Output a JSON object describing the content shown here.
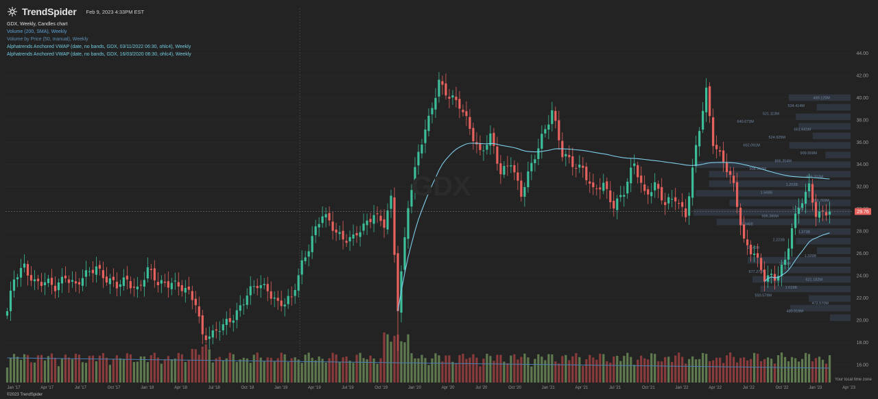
{
  "header": {
    "brand": "TrendSpider",
    "timestamp": "Feb 9, 2023 4:33PM EST"
  },
  "legend": {
    "title": "GDX, Weekly, Candles chart",
    "volume_sma": "Volume (200, SMA), Weekly",
    "vbp": "Volume by Price (50, manual), Weekly",
    "avwap1": "Alphatrends Anchored VWAP (date, no bands, GDX, 03/11/2022 06:30, ohlc4), Weekly",
    "avwap2": "Alphatrends Anchored VWAP (date, no bands, GDX, 16/03/2020 06:30, ohlc4), Weekly"
  },
  "footer": {
    "copyright": "©2023 TrendSpider",
    "timezone": "Your local time zone"
  },
  "colors": {
    "background": "#232323",
    "up": "#3dbf9c",
    "down": "#e8625e",
    "vol_up": "#5f7a4f",
    "vol_down": "#8a3b3b",
    "vwap": "#7fd0ec",
    "vbp": "#3a4656",
    "price_tag": "#e8625e"
  },
  "chart_data": {
    "type": "candlestick",
    "symbol": "GDX",
    "interval": "Weekly",
    "ylim": [
      15,
      46
    ],
    "y_ticks": [
      "16.00",
      "18.00",
      "20.00",
      "22.00",
      "24.00",
      "26.00",
      "28.00",
      "30.00",
      "32.00",
      "34.00",
      "36.00",
      "38.00",
      "40.00",
      "42.00",
      "44.00"
    ],
    "x_ticks": [
      "Jan '17",
      "Apr '17",
      "Jul '17",
      "Oct '17",
      "Jan '18",
      "Apr '18",
      "Jul '18",
      "Oct '18",
      "Jan '19",
      "Apr '19",
      "Jul '19",
      "Oct '19",
      "Jan '20",
      "Apr '20",
      "Jul '20",
      "Oct '20",
      "Jan '21",
      "Apr '21",
      "Jul '21",
      "Oct '21",
      "Jan '22",
      "Apr '22",
      "Jul '22",
      "Oct '22",
      "Jan '23",
      "Apr '23"
    ],
    "last_price": "29.76",
    "price_path": [
      [
        0,
        20.8
      ],
      [
        2,
        23.5
      ],
      [
        5,
        24.8
      ],
      [
        8,
        23.6
      ],
      [
        11,
        23.3
      ],
      [
        14,
        22.8
      ],
      [
        17,
        24.2
      ],
      [
        20,
        23.1
      ],
      [
        23,
        23.9
      ],
      [
        26,
        24.9
      ],
      [
        29,
        23.8
      ],
      [
        32,
        22.9
      ],
      [
        35,
        23.6
      ],
      [
        38,
        22.9
      ],
      [
        41,
        24.4
      ],
      [
        44,
        23.2
      ],
      [
        48,
        23.6
      ],
      [
        52,
        22.5
      ],
      [
        55,
        21.6
      ],
      [
        57,
        18.8
      ],
      [
        60,
        18.7
      ],
      [
        63,
        19.3
      ],
      [
        66,
        20.4
      ],
      [
        70,
        22.3
      ],
      [
        73,
        23.0
      ],
      [
        76,
        22.9
      ],
      [
        79,
        21.6
      ],
      [
        81,
        21.4
      ],
      [
        83,
        21.8
      ],
      [
        86,
        25.2
      ],
      [
        89,
        27.5
      ],
      [
        92,
        29.3
      ],
      [
        95,
        28.4
      ],
      [
        98,
        27.5
      ],
      [
        101,
        27.2
      ],
      [
        104,
        28.3
      ],
      [
        107,
        29.8
      ],
      [
        110,
        28.6
      ],
      [
        112,
        30.6
      ],
      [
        114,
        21.0
      ],
      [
        117,
        30.6
      ],
      [
        120,
        35.0
      ],
      [
        123,
        37.8
      ],
      [
        126,
        41.6
      ],
      [
        129,
        40.2
      ],
      [
        132,
        39.1
      ],
      [
        135,
        37.3
      ],
      [
        138,
        35.2
      ],
      [
        141,
        36.3
      ],
      [
        144,
        33.1
      ],
      [
        147,
        34.5
      ],
      [
        150,
        31.2
      ],
      [
        153,
        33.7
      ],
      [
        156,
        36.6
      ],
      [
        159,
        38.9
      ],
      [
        162,
        34.7
      ],
      [
        165,
        34.1
      ],
      [
        168,
        33.8
      ],
      [
        171,
        31.4
      ],
      [
        174,
        32.1
      ],
      [
        177,
        30.5
      ],
      [
        180,
        31.5
      ],
      [
        183,
        33.9
      ],
      [
        186,
        31.5
      ],
      [
        189,
        32.2
      ],
      [
        192,
        30.2
      ],
      [
        195,
        31.1
      ],
      [
        198,
        29.6
      ],
      [
        201,
        35.3
      ],
      [
        204,
        40.5
      ],
      [
        206,
        36.2
      ],
      [
        209,
        34.4
      ],
      [
        212,
        31.8
      ],
      [
        215,
        27.1
      ],
      [
        218,
        26.2
      ],
      [
        221,
        23.6
      ],
      [
        224,
        23.7
      ],
      [
        227,
        25.5
      ],
      [
        229,
        28.4
      ],
      [
        232,
        30.6
      ],
      [
        234,
        31.9
      ],
      [
        236,
        29.76
      ]
    ],
    "ma200_start_index": 114,
    "vbp_labels": [
      "469.125M",
      "534.414M",
      "521.113M",
      "640.673M",
      "661.641M",
      "524.925M",
      "662.091M",
      "909.559M",
      "866.354M",
      "908.917M",
      "676.203M",
      "1.203B",
      "1.568B",
      "852.769M",
      "1.063B",
      "995.280M",
      "1.346B",
      "1.373B",
      "2.223B",
      "2.143B",
      "1.329B",
      "1.073B",
      "577.272M",
      "621.182M",
      "1.019B",
      "593.579M",
      "472.570M",
      "480.916M"
    ]
  }
}
